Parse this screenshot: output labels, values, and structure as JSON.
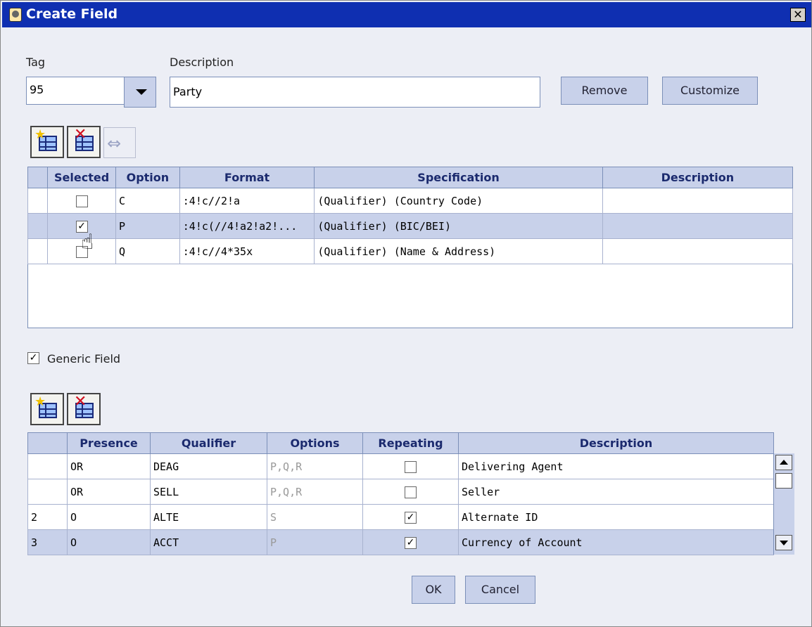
{
  "window": {
    "title": "Create Field"
  },
  "tag": {
    "label": "Tag",
    "value": "95"
  },
  "description": {
    "label": "Description",
    "value": "Party"
  },
  "buttons": {
    "remove": "Remove",
    "customize": "Customize",
    "ok": "OK",
    "cancel": "Cancel"
  },
  "toolbar1": {
    "icons": [
      "add-row-icon",
      "delete-row-icon",
      "swap-arrows-icon"
    ]
  },
  "options_table": {
    "headers": [
      "Selected",
      "Option",
      "Format",
      "Specification",
      "Description"
    ],
    "rows": [
      {
        "selected": false,
        "option": "C",
        "format": ":4!c//2!a",
        "specification": "(Qualifier) (Country Code)",
        "description": ""
      },
      {
        "selected": true,
        "option": "P",
        "format": ":4!c(//4!a2!a2!...",
        "specification": "(Qualifier) (BIC/BEI)",
        "description": ""
      },
      {
        "selected": false,
        "option": "Q",
        "format": ":4!c//4*35x",
        "specification": " (Qualifier) (Name & Address)",
        "description": ""
      }
    ]
  },
  "generic_field": {
    "label": "Generic Field",
    "checked": true
  },
  "toolbar2": {
    "icons": [
      "add-row-icon",
      "delete-row-icon"
    ]
  },
  "qualifier_table": {
    "headers": [
      "",
      "Presence",
      "Qualifier",
      "Options",
      "Repeating",
      "Description"
    ],
    "rows": [
      {
        "num": "",
        "presence": "OR",
        "qualifier": "DEAG",
        "options": "P,Q,R",
        "repeating": false,
        "description": "Delivering Agent"
      },
      {
        "num": "",
        "presence": "OR",
        "qualifier": "SELL",
        "options": "P,Q,R",
        "repeating": false,
        "description": "Seller"
      },
      {
        "num": "2",
        "presence": "O",
        "qualifier": "ALTE",
        "options": "S",
        "repeating": true,
        "description": "Alternate ID"
      },
      {
        "num": "3",
        "presence": "O",
        "qualifier": "ACCT",
        "options": "P",
        "repeating": true,
        "description": "Currency of Account"
      }
    ]
  },
  "colors": {
    "titlebar": "#0f2fb1",
    "header": "#c8d1ea",
    "background": "#eceef5"
  }
}
